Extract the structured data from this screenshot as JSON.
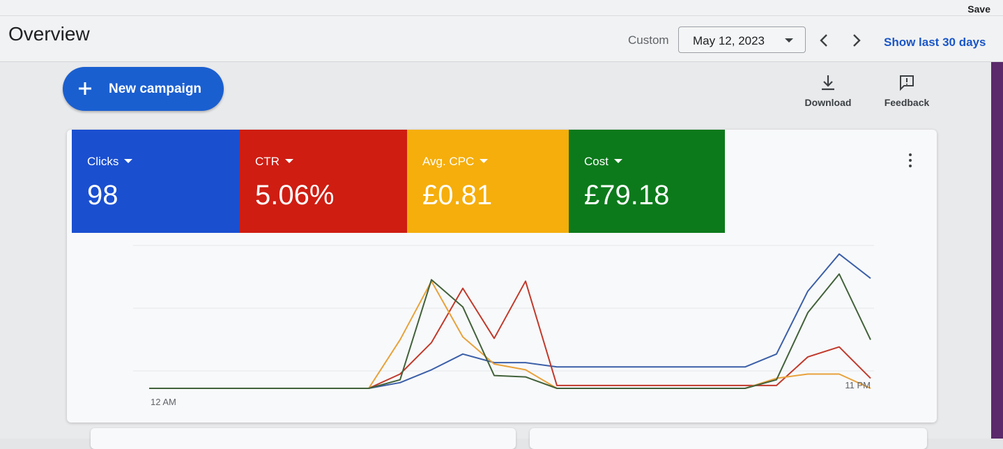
{
  "header": {
    "title": "Overview",
    "save_label": "Save",
    "custom_label": "Custom",
    "date_value": "May 12, 2023",
    "show_last": "Show last 30 days"
  },
  "toolbar": {
    "new_campaign": "New campaign",
    "download": "Download",
    "feedback": "Feedback"
  },
  "metrics": [
    {
      "name": "Clicks",
      "value": "98",
      "color": "#1a4fd0"
    },
    {
      "name": "CTR",
      "value": "5.06%",
      "color": "#cf1d12"
    },
    {
      "name": "Avg. CPC",
      "value": "£0.81",
      "color": "#f5ae0c"
    },
    {
      "name": "Cost",
      "value": "£79.18",
      "color": "#0c7a1b"
    }
  ],
  "chart_data": {
    "type": "line",
    "x_start_label": "12 AM",
    "x_end_label": "11 PM",
    "x": [
      0,
      1,
      2,
      3,
      4,
      5,
      6,
      7,
      8,
      9,
      10,
      11,
      12,
      13,
      14,
      15,
      16,
      17,
      18,
      19,
      20,
      21,
      22,
      23
    ],
    "series": [
      {
        "color": "#3b5fa8",
        "values": [
          0,
          0,
          0,
          0,
          0,
          0,
          0,
          0,
          4,
          13,
          24,
          18,
          18,
          15,
          15,
          15,
          15,
          15,
          15,
          15,
          24,
          68,
          94,
          77
        ]
      },
      {
        "color": "#c1392b",
        "values": [
          0,
          0,
          0,
          0,
          0,
          0,
          0,
          0,
          10,
          32,
          70,
          35,
          75,
          2,
          2,
          2,
          2,
          2,
          2,
          2,
          2,
          22,
          29,
          7
        ]
      },
      {
        "color": "#e8a13a",
        "values": [
          0,
          0,
          0,
          0,
          0,
          0,
          0,
          0,
          34,
          75,
          36,
          17,
          13,
          0,
          0,
          0,
          0,
          0,
          0,
          0,
          7,
          10,
          10,
          0
        ]
      },
      {
        "color": "#41613a",
        "values": [
          0,
          0,
          0,
          0,
          0,
          0,
          0,
          0,
          6,
          76,
          57,
          9,
          8,
          0,
          0,
          0,
          0,
          0,
          0,
          0,
          6,
          53,
          80,
          34
        ]
      }
    ]
  }
}
